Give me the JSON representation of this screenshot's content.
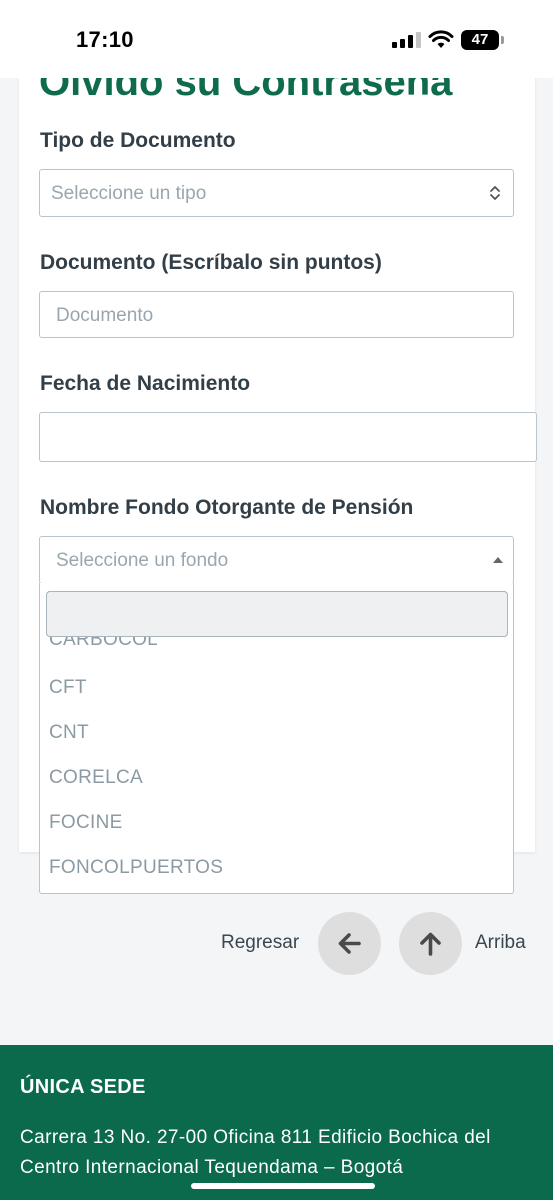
{
  "status_bar": {
    "time": "17:10",
    "battery": "47"
  },
  "form": {
    "title": "Olvido su Contraseña",
    "tipo_label": "Tipo de Documento",
    "tipo_placeholder": "Seleccione un tipo",
    "documento_label": "Documento (Escríbalo sin puntos)",
    "documento_placeholder": "Documento",
    "fecha_label": "Fecha de Nacimiento",
    "fecha_value": "",
    "fondo_label": "Nombre Fondo Otorgante de Pensión",
    "fondo_placeholder": "Seleccione un fondo"
  },
  "dropdown": {
    "search_value": "",
    "items": [
      "CARBOCOL",
      "CFT",
      "CNT",
      "CORELCA",
      "FOCINE",
      "FONCOLPUERTOS"
    ]
  },
  "nav": {
    "back_label": "Regresar",
    "top_label": "Arriba"
  },
  "footer": {
    "title": "ÚNICA SEDE",
    "address": "Carrera 13 No. 27-00 Oficina 811 Edificio Bochica del Centro Internacional Tequendama – Bogotá"
  },
  "colors": {
    "brand_green": "#0b6a4c",
    "title_green": "#0e6b4c"
  }
}
